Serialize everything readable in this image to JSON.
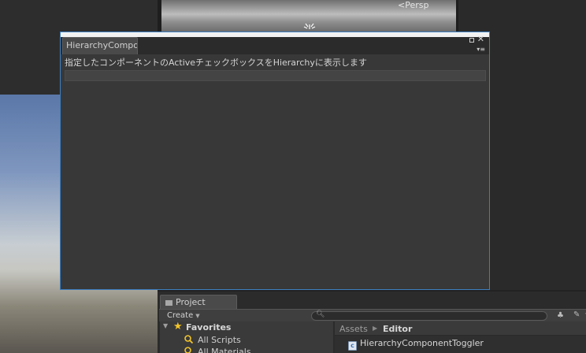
{
  "scene": {
    "perspective_label": "<Persp"
  },
  "window": {
    "tab_title": "HierarchyComponentToggler",
    "description": "指定したコンポーネントのActiveチェックボックスをHierarchyに表示します",
    "close_glyph": "✕",
    "menu_glyph": "▾≡"
  },
  "project": {
    "tab_label": "Project",
    "create_label": "Create",
    "favorites_label": "Favorites",
    "favorites_items": [
      "All Scripts",
      "All Materials"
    ],
    "breadcrumb": {
      "root": "Assets",
      "current": "Editor"
    },
    "files": [
      {
        "name": "HierarchyComponentToggler",
        "icon": "cs-script-icon"
      }
    ]
  },
  "colors": {
    "window_border": "#3d7fc1",
    "favorites_star": "#f2c52b"
  }
}
